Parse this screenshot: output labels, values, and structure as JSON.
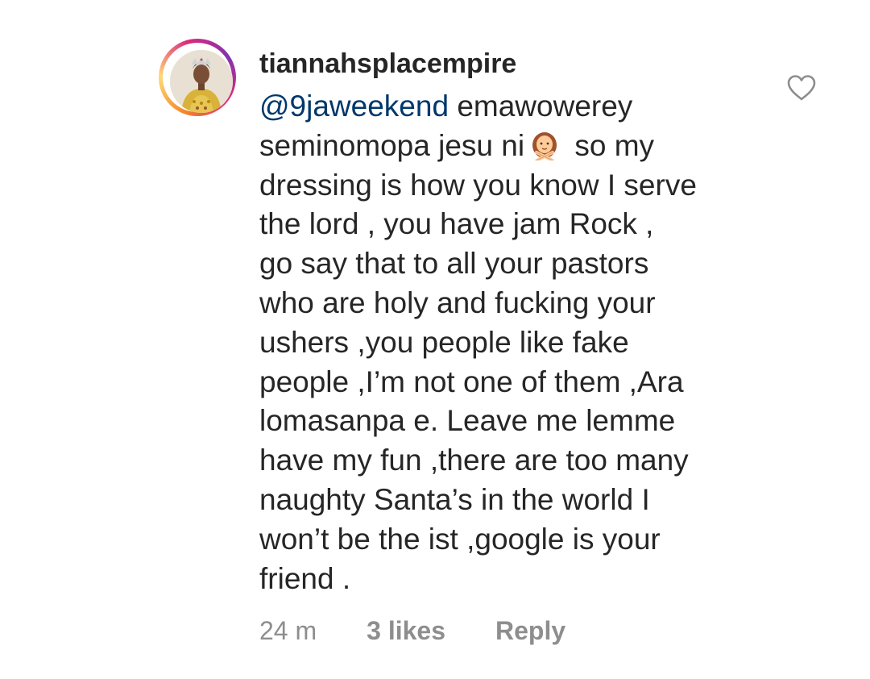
{
  "comment": {
    "username": "tiannahsplacempire",
    "mention": "@9jaweekend",
    "lines": [
      " emawowerey",
      "seminomopa jesu ni",
      " so my",
      "dressing is how you know I serve",
      "the lord , you have jam Rock ,",
      "go say that to all your pastors",
      "who are holy and fucking your",
      "ushers ,you people like fake",
      "people ,I’m not one of them ,Ara",
      "lomasanpa e. Leave me lemme",
      "have my fun ,there are too many",
      "naughty Santa’s in the world I",
      "won’t be the ist ,google is your",
      "friend ."
    ],
    "emoji": "person-gesturing-no-icon",
    "time": "24 m",
    "likes": "3 likes",
    "reply": "Reply"
  },
  "icons": {
    "like": "heart-outline-icon",
    "avatar": "profile-avatar"
  },
  "colors": {
    "text": "#262626",
    "mention": "#00376b",
    "meta": "#8e8e8e",
    "background": "#ffffff"
  }
}
